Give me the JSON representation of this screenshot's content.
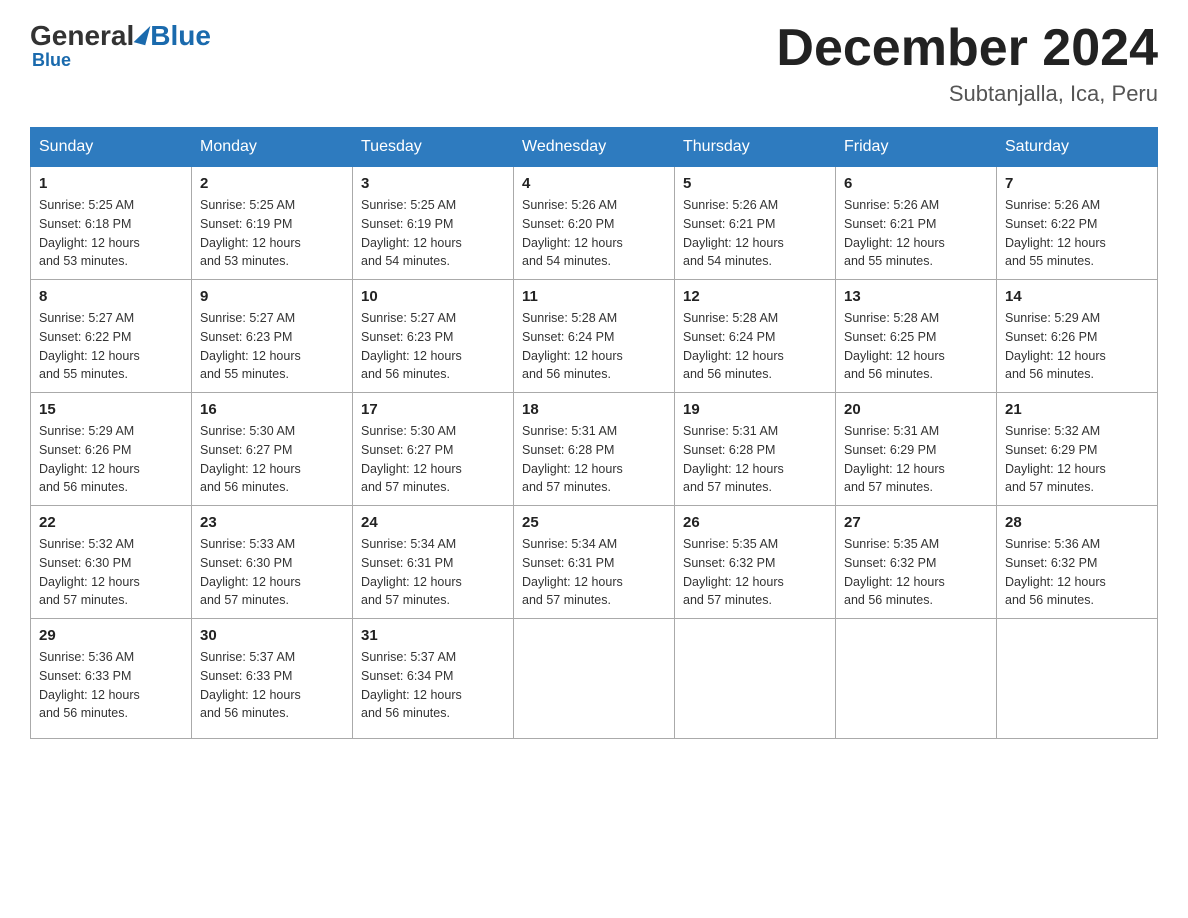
{
  "header": {
    "logo_general": "General",
    "logo_blue": "Blue",
    "month_title": "December 2024",
    "location": "Subtanjalla, Ica, Peru"
  },
  "days_of_week": [
    "Sunday",
    "Monday",
    "Tuesday",
    "Wednesday",
    "Thursday",
    "Friday",
    "Saturday"
  ],
  "weeks": [
    [
      {
        "day": "1",
        "sunrise": "5:25 AM",
        "sunset": "6:18 PM",
        "daylight": "12 hours and 53 minutes."
      },
      {
        "day": "2",
        "sunrise": "5:25 AM",
        "sunset": "6:19 PM",
        "daylight": "12 hours and 53 minutes."
      },
      {
        "day": "3",
        "sunrise": "5:25 AM",
        "sunset": "6:19 PM",
        "daylight": "12 hours and 54 minutes."
      },
      {
        "day": "4",
        "sunrise": "5:26 AM",
        "sunset": "6:20 PM",
        "daylight": "12 hours and 54 minutes."
      },
      {
        "day": "5",
        "sunrise": "5:26 AM",
        "sunset": "6:21 PM",
        "daylight": "12 hours and 54 minutes."
      },
      {
        "day": "6",
        "sunrise": "5:26 AM",
        "sunset": "6:21 PM",
        "daylight": "12 hours and 55 minutes."
      },
      {
        "day": "7",
        "sunrise": "5:26 AM",
        "sunset": "6:22 PM",
        "daylight": "12 hours and 55 minutes."
      }
    ],
    [
      {
        "day": "8",
        "sunrise": "5:27 AM",
        "sunset": "6:22 PM",
        "daylight": "12 hours and 55 minutes."
      },
      {
        "day": "9",
        "sunrise": "5:27 AM",
        "sunset": "6:23 PM",
        "daylight": "12 hours and 55 minutes."
      },
      {
        "day": "10",
        "sunrise": "5:27 AM",
        "sunset": "6:23 PM",
        "daylight": "12 hours and 56 minutes."
      },
      {
        "day": "11",
        "sunrise": "5:28 AM",
        "sunset": "6:24 PM",
        "daylight": "12 hours and 56 minutes."
      },
      {
        "day": "12",
        "sunrise": "5:28 AM",
        "sunset": "6:24 PM",
        "daylight": "12 hours and 56 minutes."
      },
      {
        "day": "13",
        "sunrise": "5:28 AM",
        "sunset": "6:25 PM",
        "daylight": "12 hours and 56 minutes."
      },
      {
        "day": "14",
        "sunrise": "5:29 AM",
        "sunset": "6:26 PM",
        "daylight": "12 hours and 56 minutes."
      }
    ],
    [
      {
        "day": "15",
        "sunrise": "5:29 AM",
        "sunset": "6:26 PM",
        "daylight": "12 hours and 56 minutes."
      },
      {
        "day": "16",
        "sunrise": "5:30 AM",
        "sunset": "6:27 PM",
        "daylight": "12 hours and 56 minutes."
      },
      {
        "day": "17",
        "sunrise": "5:30 AM",
        "sunset": "6:27 PM",
        "daylight": "12 hours and 57 minutes."
      },
      {
        "day": "18",
        "sunrise": "5:31 AM",
        "sunset": "6:28 PM",
        "daylight": "12 hours and 57 minutes."
      },
      {
        "day": "19",
        "sunrise": "5:31 AM",
        "sunset": "6:28 PM",
        "daylight": "12 hours and 57 minutes."
      },
      {
        "day": "20",
        "sunrise": "5:31 AM",
        "sunset": "6:29 PM",
        "daylight": "12 hours and 57 minutes."
      },
      {
        "day": "21",
        "sunrise": "5:32 AM",
        "sunset": "6:29 PM",
        "daylight": "12 hours and 57 minutes."
      }
    ],
    [
      {
        "day": "22",
        "sunrise": "5:32 AM",
        "sunset": "6:30 PM",
        "daylight": "12 hours and 57 minutes."
      },
      {
        "day": "23",
        "sunrise": "5:33 AM",
        "sunset": "6:30 PM",
        "daylight": "12 hours and 57 minutes."
      },
      {
        "day": "24",
        "sunrise": "5:34 AM",
        "sunset": "6:31 PM",
        "daylight": "12 hours and 57 minutes."
      },
      {
        "day": "25",
        "sunrise": "5:34 AM",
        "sunset": "6:31 PM",
        "daylight": "12 hours and 57 minutes."
      },
      {
        "day": "26",
        "sunrise": "5:35 AM",
        "sunset": "6:32 PM",
        "daylight": "12 hours and 57 minutes."
      },
      {
        "day": "27",
        "sunrise": "5:35 AM",
        "sunset": "6:32 PM",
        "daylight": "12 hours and 56 minutes."
      },
      {
        "day": "28",
        "sunrise": "5:36 AM",
        "sunset": "6:32 PM",
        "daylight": "12 hours and 56 minutes."
      }
    ],
    [
      {
        "day": "29",
        "sunrise": "5:36 AM",
        "sunset": "6:33 PM",
        "daylight": "12 hours and 56 minutes."
      },
      {
        "day": "30",
        "sunrise": "5:37 AM",
        "sunset": "6:33 PM",
        "daylight": "12 hours and 56 minutes."
      },
      {
        "day": "31",
        "sunrise": "5:37 AM",
        "sunset": "6:34 PM",
        "daylight": "12 hours and 56 minutes."
      },
      null,
      null,
      null,
      null
    ]
  ]
}
